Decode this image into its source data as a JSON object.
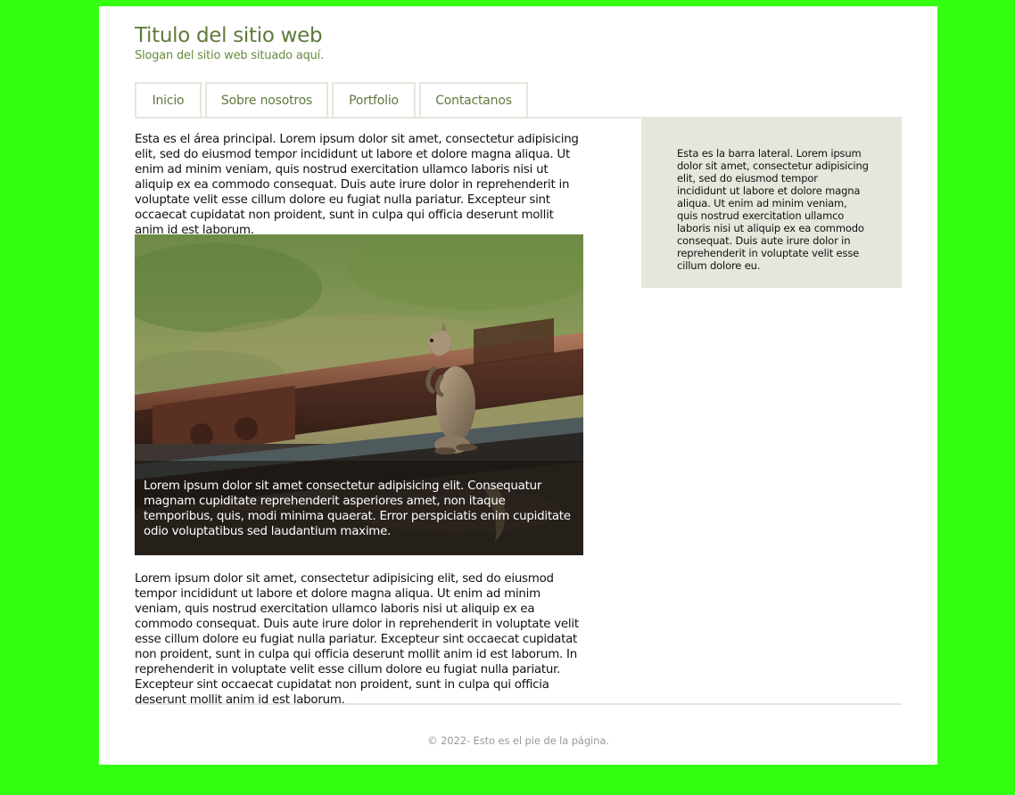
{
  "header": {
    "title": "Titulo del sitio web",
    "slogan": "Slogan del sitio web situado aquí."
  },
  "nav": {
    "items": [
      {
        "label": "Inicio"
      },
      {
        "label": "Sobre nosotros"
      },
      {
        "label": "Portfolio"
      },
      {
        "label": "Contactanos"
      }
    ]
  },
  "main": {
    "intro": "Esta es el área principal. Lorem ipsum dolor sit amet, consectetur adipisicing elit, sed do eiusmod tempor incididunt ut labore et dolore magna aliqua. Ut enim ad minim veniam, quis nostrud exercitation ullamco laboris nisi ut aliquip ex ea commodo consequat. Duis aute irure dolor in reprehenderit in voluptate velit esse cillum dolore eu fugiat nulla pariatur. Excepteur sint occaecat cupidatat non proident, sunt in culpa qui officia deserunt mollit anim id est laborum.",
    "figure": {
      "image": "squirrel-on-rail-photo",
      "caption": "Lorem ipsum dolor sit amet consectetur adipisicing elit. Consequatur magnam cupiditate reprehenderit asperiores amet, non itaque temporibus, quis, modi minima quaerat. Error perspiciatis enim cupiditate odio voluptatibus sed laudantium maxime."
    },
    "body": "Lorem ipsum dolor sit amet, consectetur adipisicing elit, sed do eiusmod tempor incididunt ut labore et dolore magna aliqua. Ut enim ad minim veniam, quis nostrud exercitation ullamco laboris nisi ut aliquip ex ea commodo consequat. Duis aute irure dolor in reprehenderit in voluptate velit esse cillum dolore eu fugiat nulla pariatur. Excepteur sint occaecat cupidatat non proident, sunt in culpa qui officia deserunt mollit anim id est laborum. In reprehenderit in voluptate velit esse cillum dolore eu fugiat nulla pariatur. Excepteur sint occaecat cupidatat non proident, sunt in culpa qui officia deserunt mollit anim id est laborum."
  },
  "sidebar": {
    "text": "Esta es la barra lateral. Lorem ipsum dolor sit amet, consectetur adipisicing elit, sed do eiusmod tempor incididunt ut labore et dolore magna aliqua. Ut enim ad minim veniam, quis nostrud exercitation ullamco laboris nisi ut aliquip ex ea commodo consequat. Duis aute irure dolor in reprehenderit in voluptate velit esse cillum dolore eu."
  },
  "footer": {
    "text": "© 2022- Esto es el pie de la página."
  },
  "colors": {
    "background": "#33ff11",
    "accent": "#5e7a3a",
    "sidebar_bg": "#e4e7dc",
    "footer_text": "#999999"
  }
}
